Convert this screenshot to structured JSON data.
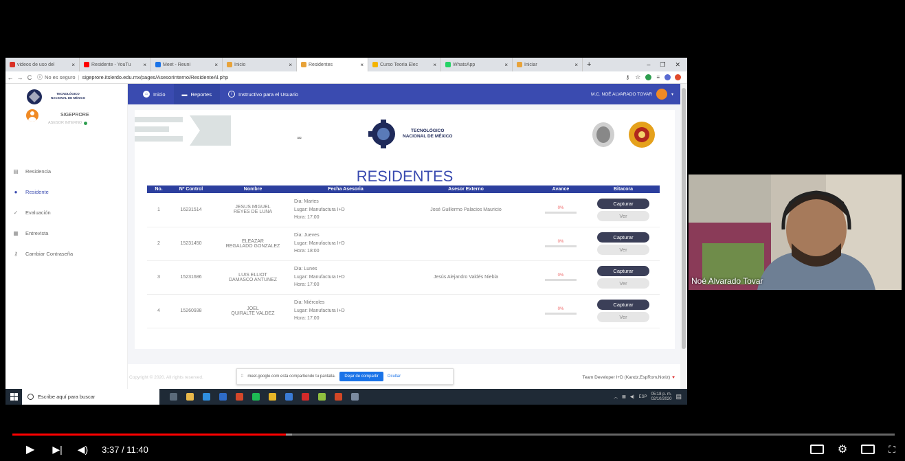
{
  "browser": {
    "tabs": [
      {
        "label": "videos de uso del",
        "color": "#d93025",
        "icon": "gmail-icon"
      },
      {
        "label": "Residente - YouTu",
        "color": "#ff0000",
        "icon": "youtube-icon"
      },
      {
        "label": "Meet - Reuni",
        "color": "#1a73e8",
        "icon": "meet-icon"
      },
      {
        "label": "Inicio",
        "color": "#e8a33a",
        "icon": "site-icon"
      },
      {
        "label": "Residentes",
        "color": "#e8a33a",
        "icon": "site-icon",
        "active": true
      },
      {
        "label": "Curso Teoria Elec",
        "color": "#f4b400",
        "icon": "drive-icon"
      },
      {
        "label": "WhatsApp",
        "color": "#25d366",
        "icon": "whatsapp-icon"
      },
      {
        "label": "Iniciar",
        "color": "#e8a33a",
        "icon": "site-icon"
      }
    ],
    "address_security": "No es seguro",
    "url": "sigeprore.itslerdo.edu.mx/pages/AsesorInterno/ResidenteAl.php"
  },
  "sidebar": {
    "logo_text": "TECNOLÓGICO NACIONAL DE MÉXICO",
    "app_name": "SIGEPRORE",
    "role": "ASESOR INTERNO",
    "items": [
      {
        "label": "Residencia",
        "icon": "document-icon"
      },
      {
        "label": "Residente",
        "icon": "user-icon",
        "active": true
      },
      {
        "label": "Evaluación",
        "icon": "check-circle-icon"
      },
      {
        "label": "Entrevista",
        "icon": "grid-icon"
      },
      {
        "label": "Cambiar Contraseña",
        "icon": "key-icon"
      }
    ]
  },
  "topnav": {
    "inicio": "Inicio",
    "reportes": "Reportes",
    "instructivo": "Instructivo para el Usuario",
    "user": "M.C. NOÉ ALVARADO TOVAR"
  },
  "banner": {
    "logo_line1": "TECNOLÓGICO",
    "logo_line2": "NACIONAL DE MÉXICO"
  },
  "page_title": "RESIDENTES",
  "table": {
    "headers": [
      "No.",
      "Nº Control",
      "Nombre",
      "Fecha Asesoria",
      "Asesor Externo",
      "Avance",
      "Bitacora"
    ],
    "rows": [
      {
        "no": "1",
        "control": "16231514",
        "nombre1": "JESUS MIGUEL",
        "nombre2": "REYES DE LUNA",
        "dia": "Dia: Martes",
        "lugar": "Lugar: Manufactura I+D",
        "hora": "Hora: 17:00",
        "asesor": "José Guillermo Palacios Mauricio",
        "avance": "0%",
        "capturar": "Capturar",
        "ver": "Ver"
      },
      {
        "no": "2",
        "control": "15231450",
        "nombre1": "ELEAZAR",
        "nombre2": "REGALADO GONZALEZ",
        "dia": "Dia: Jueves",
        "lugar": "Lugar: Manufactura I+D",
        "hora": "Hora: 18:00",
        "asesor": "",
        "avance": "0%",
        "capturar": "Capturar",
        "ver": "Ver"
      },
      {
        "no": "3",
        "control": "15231686",
        "nombre1": "LUIS ELLIOT",
        "nombre2": "DAMASCO ANTUNEZ",
        "dia": "Dia: Lunes",
        "lugar": "Lugar: Manufactura I+D",
        "hora": "Hora: 17:00",
        "asesor": "Jesús Alejandro Valdés Niebla",
        "avance": "0%",
        "capturar": "Capturar",
        "ver": "Ver"
      },
      {
        "no": "4",
        "control": "15260938",
        "nombre1": "JOEL",
        "nombre2": "QUIRALTE VALDEZ",
        "dia": "Dia: Miércoles",
        "lugar": "Lugar: Manufactura I+D",
        "hora": "Hora: 17:00",
        "asesor": "",
        "avance": "0%",
        "capturar": "Capturar",
        "ver": "Ver"
      }
    ]
  },
  "footer": {
    "copyright": "Copyright © 2020. All rights reserved.",
    "share_msg": "meet.google.com está compartiendo tu pantalla.",
    "stop_share": "Dejar de compartir",
    "hide": "Ocultar",
    "team": "Team Developer I+D (Kandz,EspRom,Noriz)"
  },
  "taskbar": {
    "search": "Escribe aquí para buscar",
    "lang": "ESP",
    "time": "05:18 p. m.",
    "date": "02/10/2020"
  },
  "webcam": {
    "name": "Noé Alvarado Tovar"
  },
  "player": {
    "time": "3:37 / 11:40",
    "progress": 0.31
  }
}
